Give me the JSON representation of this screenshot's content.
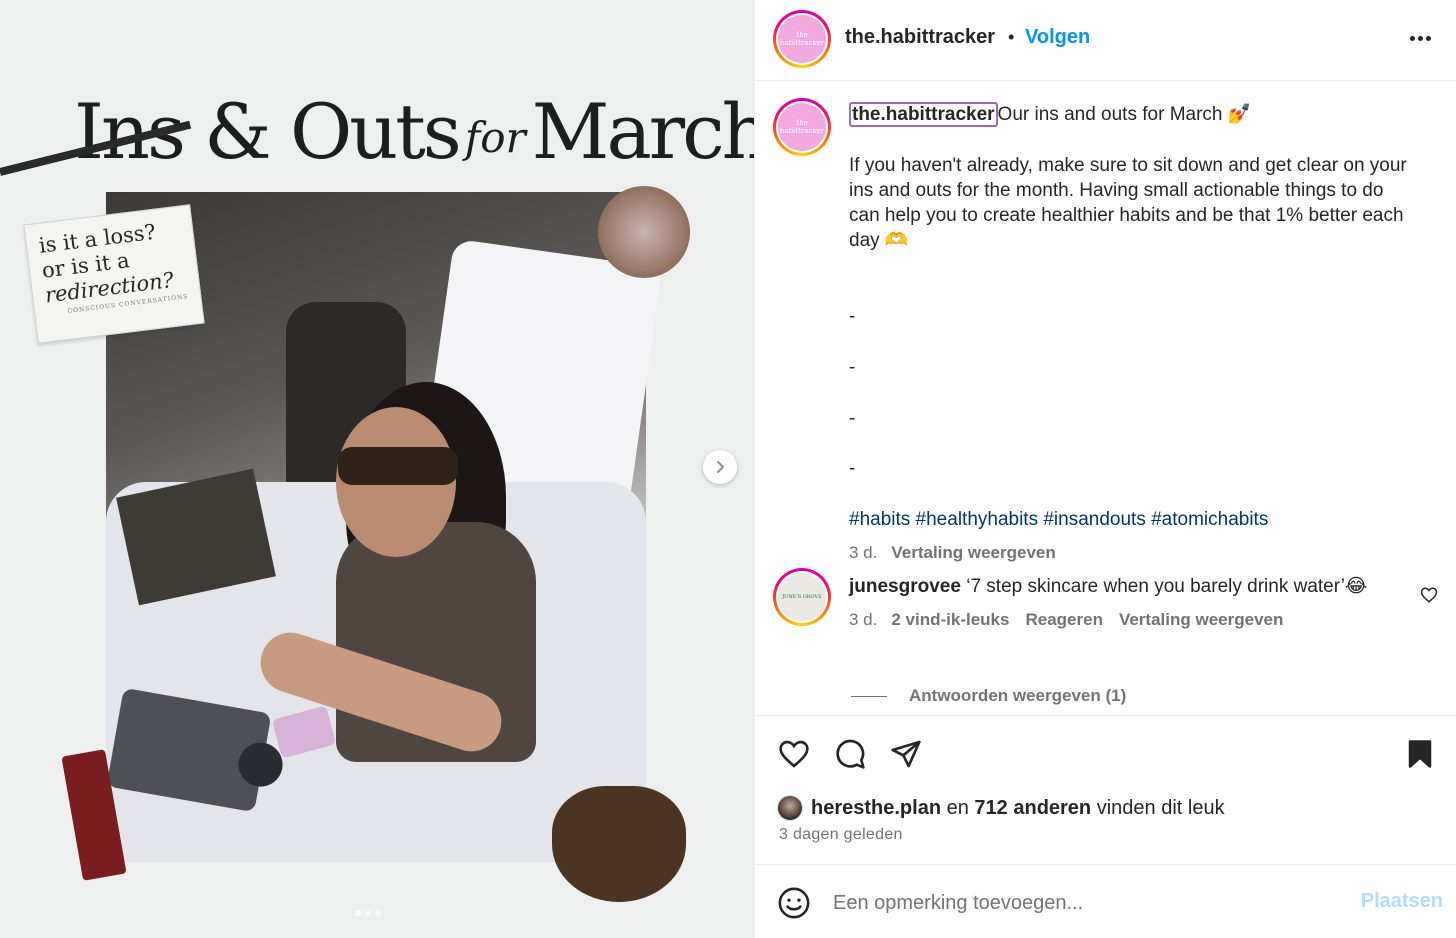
{
  "media": {
    "title_part1": "Ins & Outs",
    "title_script": "for",
    "title_part2": "March",
    "sign": {
      "line1": "is it a loss?",
      "line2": "or is it a",
      "line3": "redirection?",
      "line4": "CONSCIOUS CONVERSATIONS"
    },
    "carousel_dots": 3,
    "active_dot": 0
  },
  "header": {
    "avatar_text": "the habittracker",
    "username": "the.habittracker",
    "separator": "•",
    "follow_label": "Volgen"
  },
  "caption": {
    "username": "the.habittracker",
    "title": "Our ins and outs for March 💅",
    "body": "If you haven't already, make sure to sit down and get clear on your ins and outs for the month. Having small actionable things to do can help you to create healthier habits and be that 1% better each day 🫶",
    "dashes": [
      "-",
      "-",
      "-",
      "-"
    ],
    "hashtags": "#habits #healthyhabits #insandouts #atomichabits",
    "time": "3 d.",
    "translate": "Vertaling weergeven"
  },
  "comment": {
    "avatar_text": "JUNE'S GROVE",
    "username": "junesgrovee",
    "text": "‘7 step skincare when you barely drink water’😂",
    "time": "3 d.",
    "likes": "2 vind-ik-leuks",
    "reply": "Reageren",
    "translate": "Vertaling weergeven",
    "view_replies": "Antwoorden weergeven (1)"
  },
  "likes": {
    "user": "heresthe.plan",
    "joiner": "en",
    "others": "712 anderen",
    "suffix": "vinden dit leuk"
  },
  "posted": "3 dagen geleden",
  "add_comment": {
    "placeholder": "Een opmerking toevoegen...",
    "post_label": "Plaatsen"
  },
  "icons": {
    "like": "heart-icon",
    "comment": "comment-icon",
    "share": "send-icon",
    "save": "bookmark-icon",
    "emoji": "smiley-icon",
    "next": "chevron-right-icon",
    "more": "more-horizontal-icon"
  },
  "colors": {
    "accent": "#0095f6",
    "hashtag": "#00376b",
    "muted": "#737373",
    "post_disabled": "#b3dbff"
  }
}
